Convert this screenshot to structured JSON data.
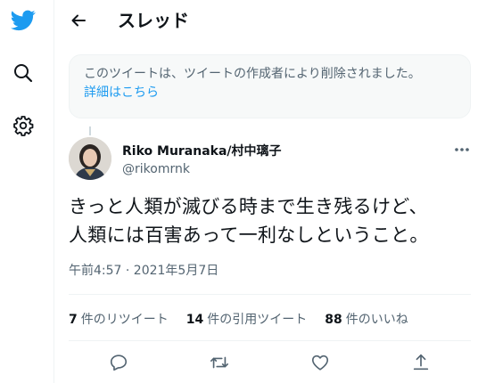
{
  "header": {
    "title": "スレッド"
  },
  "notice": {
    "text": "このツイートは、ツイートの作成者により削除されました。",
    "link": "詳細はこちら"
  },
  "tweet": {
    "author_name": "Riko Muranaka/村中璃子",
    "handle": "@rikomrnk",
    "text_line1": "きっと人類が滅びる時まで生き残るけど、",
    "text_line2": "人類には百害あって一利なしということ。",
    "timestamp": "午前4:57 · 2021年5月7日"
  },
  "stats": {
    "retweets_count": "7",
    "retweets_label": "件のリツイート",
    "quotes_count": "14",
    "quotes_label": "件の引用ツイート",
    "likes_count": "88",
    "likes_label": "件のいいね"
  },
  "colors": {
    "accent": "#1d9bf0",
    "muted": "#536471",
    "text": "#0f1419"
  },
  "icons": [
    "twitter-logo-icon",
    "search-icon",
    "gear-icon",
    "back-arrow-icon",
    "more-icon",
    "reply-icon",
    "retweet-icon",
    "like-icon",
    "share-icon"
  ]
}
